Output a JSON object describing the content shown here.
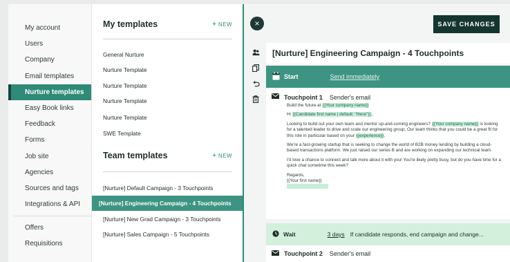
{
  "nav": {
    "items": [
      {
        "label": "My account"
      },
      {
        "label": "Users"
      },
      {
        "label": "Company"
      },
      {
        "label": "Email templates"
      },
      {
        "label": "Nurture templates",
        "active": true
      },
      {
        "label": "Easy Book links"
      },
      {
        "label": "Feedback"
      },
      {
        "label": "Forms"
      },
      {
        "label": "Job site"
      },
      {
        "label": "Agencies"
      },
      {
        "label": "Sources and tags"
      },
      {
        "label": "Integrations & API"
      }
    ],
    "secondary": [
      {
        "label": "Offers"
      },
      {
        "label": "Requisitions"
      }
    ]
  },
  "my_templates": {
    "title": "My templates",
    "new_label": "NEW",
    "items": [
      "General Nurture",
      "Nurture Template",
      "Nurture Template",
      "Nurture Template",
      "Nurture Template",
      "SWE Template"
    ]
  },
  "team_templates": {
    "title": "Team templates",
    "new_label": "NEW",
    "items": [
      "[Nurture] Default Campaign - 3 Touchpoints",
      "[Nurture] Engineering Campaign - 4 Touchpoints",
      "[Nurture] New Grad Campaign - 3 Touchpoints",
      "[Nurture] Sales Campaign - 5 Touchpoints"
    ],
    "selected_index": 1
  },
  "editor": {
    "close_icon": "×",
    "save_label": "SAVE CHANGES",
    "campaign_title": "[Nurture] Engineering Campaign - 4 Touchpoints",
    "start": {
      "label": "Start",
      "send": "Send immediately"
    },
    "touchpoint1": {
      "name": "Touchpoint 1",
      "sender": "Sender's email",
      "subject_prefix": "Build the future at ",
      "subject_var": "{{Your company name}}",
      "greet_prefix": "Hi ",
      "greet_var": "{{Candidate first name | default: \"there\"}}",
      "greet_suffix": ",",
      "p1_a": "Looking to build out your own team and mentor up-and-coming engineers? ",
      "p1_var": "{{Your company name}}",
      "p1_b": " is looking for a talented leader to drive and scale our engineering group. Our team thinks that you could be a great fit for this role in particular based on your ",
      "p1_var2": "{{experience}}",
      "p1_c": ".",
      "p2": "We're a fast-growing startup that is seeking to change the world of B2B money lending by building a cloud-based transactions platform. We just raised our series B and are working on expanding our technical team.",
      "p3": "I'd love a chance to connect and talk more about it with you! You're likely pretty busy, but do you have time for a quick chat sometime this week?",
      "regards": "Regards,",
      "sig_var": "{{Your first name}}"
    },
    "wait": {
      "label": "Wait",
      "days": "3 days",
      "condition": "If candidate responds, end campaign and change..."
    },
    "touchpoint2": {
      "name": "Touchpoint 2",
      "sender": "Sender's email"
    }
  },
  "colors": {
    "accent": "#2f8a78",
    "dark": "#14362f",
    "variable_bg": "#c7eed9",
    "wait_bg": "#d3f0dd"
  },
  "icons": [
    "users-icon",
    "copy-icon",
    "undo-icon",
    "trash-icon",
    "calendar-icon",
    "envelope-icon",
    "clock-icon",
    "close-icon",
    "plus-icon"
  ]
}
